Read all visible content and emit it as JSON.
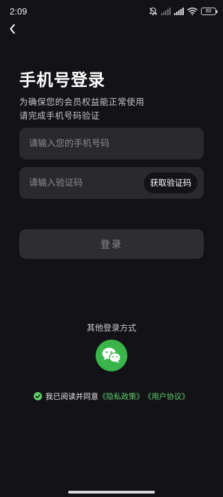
{
  "status_bar": {
    "time": "2:09",
    "battery": "83",
    "icons": [
      "bell-muted-icon",
      "signal-icon-1",
      "signal-icon-2",
      "wifi-icon",
      "battery-icon"
    ]
  },
  "header": {
    "back_icon": "chevron-left-icon"
  },
  "page": {
    "title": "手机号登录",
    "subtitle_line1": "为确保您的会员权益能正常使用",
    "subtitle_line2": "请完成手机号码验证"
  },
  "form": {
    "phone_placeholder": "请输入您的手机号码",
    "phone_value": "",
    "code_placeholder": "请输入验证码",
    "code_value": "",
    "get_code_label": "获取验证码",
    "login_label": "登录"
  },
  "other_login": {
    "label": "其他登录方式",
    "wechat_icon": "wechat-icon",
    "wechat_color": "#39b54a"
  },
  "agreement": {
    "checked": true,
    "text": "我已阅读并同意",
    "privacy_link": "《隐私政策》",
    "user_link": "《用户协议》",
    "link_color": "#5fcf6a"
  },
  "theme": {
    "background": "#121217",
    "field_background": "#2a2a2e",
    "accent": "#39b54a"
  }
}
